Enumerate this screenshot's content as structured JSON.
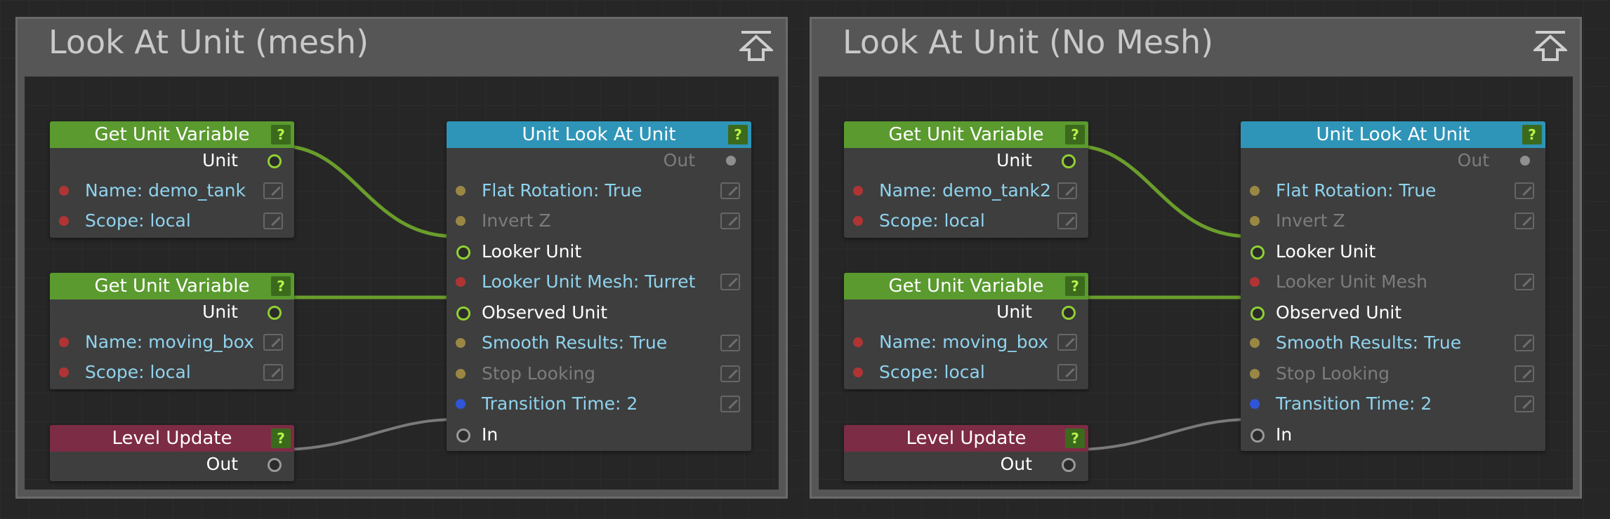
{
  "groups": [
    {
      "title": "Look At Unit (mesh)",
      "get_var_1": {
        "title": "Get Unit Variable",
        "help": "?",
        "output": "Unit",
        "name": "Name: demo_tank",
        "scope": "Scope: local"
      },
      "get_var_2": {
        "title": "Get Unit Variable",
        "help": "?",
        "output": "Unit",
        "name": "Name: moving_box",
        "scope": "Scope: local"
      },
      "level_update": {
        "title": "Level Update",
        "help": "?",
        "output": "Out"
      },
      "look_at": {
        "title": "Unit Look At Unit",
        "help": "?",
        "out": "Out",
        "flat_rotation": "Flat Rotation: True",
        "invert_z": "Invert Z",
        "looker_unit": "Looker Unit",
        "looker_mesh": "Looker Unit Mesh: Turret",
        "observed_unit": "Observed Unit",
        "smooth_results": "Smooth Results: True",
        "stop_looking": "Stop Looking",
        "transition_time": "Transition Time: 2",
        "in": "In"
      }
    },
    {
      "title": "Look At Unit (No Mesh)",
      "get_var_1": {
        "title": "Get Unit Variable",
        "help": "?",
        "output": "Unit",
        "name": "Name: demo_tank2",
        "scope": "Scope: local"
      },
      "get_var_2": {
        "title": "Get Unit Variable",
        "help": "?",
        "output": "Unit",
        "name": "Name: moving_box",
        "scope": "Scope: local"
      },
      "level_update": {
        "title": "Level Update",
        "help": "?",
        "output": "Out"
      },
      "look_at": {
        "title": "Unit Look At Unit",
        "help": "?",
        "out": "Out",
        "flat_rotation": "Flat Rotation: True",
        "invert_z": "Invert Z",
        "looker_unit": "Looker Unit",
        "looker_mesh": "Looker Unit Mesh",
        "observed_unit": "Observed Unit",
        "smooth_results": "Smooth Results: True",
        "stop_looking": "Stop Looking",
        "transition_time": "Transition Time: 2",
        "in": "In"
      }
    }
  ],
  "icons": {
    "collapse": "collapse-to-top-icon",
    "edit": "edit-pencil-icon",
    "help": "help-icon"
  },
  "colors": {
    "get_variable_header": "#5a9a2f",
    "look_at_header": "#2f95b8",
    "level_update_header": "#7d2c45",
    "unit_wire": "#6a9d2c",
    "event_wire": "#7a7a7a"
  }
}
